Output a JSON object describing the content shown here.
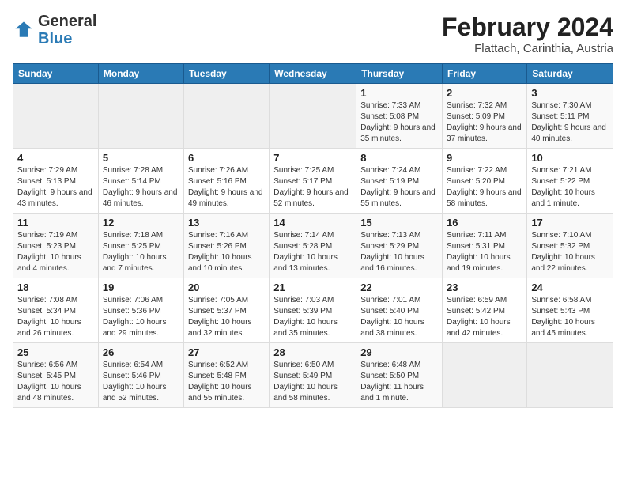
{
  "header": {
    "logo_general": "General",
    "logo_blue": "Blue",
    "month_title": "February 2024",
    "location": "Flattach, Carinthia, Austria"
  },
  "days_of_week": [
    "Sunday",
    "Monday",
    "Tuesday",
    "Wednesday",
    "Thursday",
    "Friday",
    "Saturday"
  ],
  "weeks": [
    [
      {
        "day": "",
        "info": ""
      },
      {
        "day": "",
        "info": ""
      },
      {
        "day": "",
        "info": ""
      },
      {
        "day": "",
        "info": ""
      },
      {
        "day": "1",
        "info": "Sunrise: 7:33 AM\nSunset: 5:08 PM\nDaylight: 9 hours and 35 minutes."
      },
      {
        "day": "2",
        "info": "Sunrise: 7:32 AM\nSunset: 5:09 PM\nDaylight: 9 hours and 37 minutes."
      },
      {
        "day": "3",
        "info": "Sunrise: 7:30 AM\nSunset: 5:11 PM\nDaylight: 9 hours and 40 minutes."
      }
    ],
    [
      {
        "day": "4",
        "info": "Sunrise: 7:29 AM\nSunset: 5:13 PM\nDaylight: 9 hours and 43 minutes."
      },
      {
        "day": "5",
        "info": "Sunrise: 7:28 AM\nSunset: 5:14 PM\nDaylight: 9 hours and 46 minutes."
      },
      {
        "day": "6",
        "info": "Sunrise: 7:26 AM\nSunset: 5:16 PM\nDaylight: 9 hours and 49 minutes."
      },
      {
        "day": "7",
        "info": "Sunrise: 7:25 AM\nSunset: 5:17 PM\nDaylight: 9 hours and 52 minutes."
      },
      {
        "day": "8",
        "info": "Sunrise: 7:24 AM\nSunset: 5:19 PM\nDaylight: 9 hours and 55 minutes."
      },
      {
        "day": "9",
        "info": "Sunrise: 7:22 AM\nSunset: 5:20 PM\nDaylight: 9 hours and 58 minutes."
      },
      {
        "day": "10",
        "info": "Sunrise: 7:21 AM\nSunset: 5:22 PM\nDaylight: 10 hours and 1 minute."
      }
    ],
    [
      {
        "day": "11",
        "info": "Sunrise: 7:19 AM\nSunset: 5:23 PM\nDaylight: 10 hours and 4 minutes."
      },
      {
        "day": "12",
        "info": "Sunrise: 7:18 AM\nSunset: 5:25 PM\nDaylight: 10 hours and 7 minutes."
      },
      {
        "day": "13",
        "info": "Sunrise: 7:16 AM\nSunset: 5:26 PM\nDaylight: 10 hours and 10 minutes."
      },
      {
        "day": "14",
        "info": "Sunrise: 7:14 AM\nSunset: 5:28 PM\nDaylight: 10 hours and 13 minutes."
      },
      {
        "day": "15",
        "info": "Sunrise: 7:13 AM\nSunset: 5:29 PM\nDaylight: 10 hours and 16 minutes."
      },
      {
        "day": "16",
        "info": "Sunrise: 7:11 AM\nSunset: 5:31 PM\nDaylight: 10 hours and 19 minutes."
      },
      {
        "day": "17",
        "info": "Sunrise: 7:10 AM\nSunset: 5:32 PM\nDaylight: 10 hours and 22 minutes."
      }
    ],
    [
      {
        "day": "18",
        "info": "Sunrise: 7:08 AM\nSunset: 5:34 PM\nDaylight: 10 hours and 26 minutes."
      },
      {
        "day": "19",
        "info": "Sunrise: 7:06 AM\nSunset: 5:36 PM\nDaylight: 10 hours and 29 minutes."
      },
      {
        "day": "20",
        "info": "Sunrise: 7:05 AM\nSunset: 5:37 PM\nDaylight: 10 hours and 32 minutes."
      },
      {
        "day": "21",
        "info": "Sunrise: 7:03 AM\nSunset: 5:39 PM\nDaylight: 10 hours and 35 minutes."
      },
      {
        "day": "22",
        "info": "Sunrise: 7:01 AM\nSunset: 5:40 PM\nDaylight: 10 hours and 38 minutes."
      },
      {
        "day": "23",
        "info": "Sunrise: 6:59 AM\nSunset: 5:42 PM\nDaylight: 10 hours and 42 minutes."
      },
      {
        "day": "24",
        "info": "Sunrise: 6:58 AM\nSunset: 5:43 PM\nDaylight: 10 hours and 45 minutes."
      }
    ],
    [
      {
        "day": "25",
        "info": "Sunrise: 6:56 AM\nSunset: 5:45 PM\nDaylight: 10 hours and 48 minutes."
      },
      {
        "day": "26",
        "info": "Sunrise: 6:54 AM\nSunset: 5:46 PM\nDaylight: 10 hours and 52 minutes."
      },
      {
        "day": "27",
        "info": "Sunrise: 6:52 AM\nSunset: 5:48 PM\nDaylight: 10 hours and 55 minutes."
      },
      {
        "day": "28",
        "info": "Sunrise: 6:50 AM\nSunset: 5:49 PM\nDaylight: 10 hours and 58 minutes."
      },
      {
        "day": "29",
        "info": "Sunrise: 6:48 AM\nSunset: 5:50 PM\nDaylight: 11 hours and 1 minute."
      },
      {
        "day": "",
        "info": ""
      },
      {
        "day": "",
        "info": ""
      }
    ]
  ]
}
